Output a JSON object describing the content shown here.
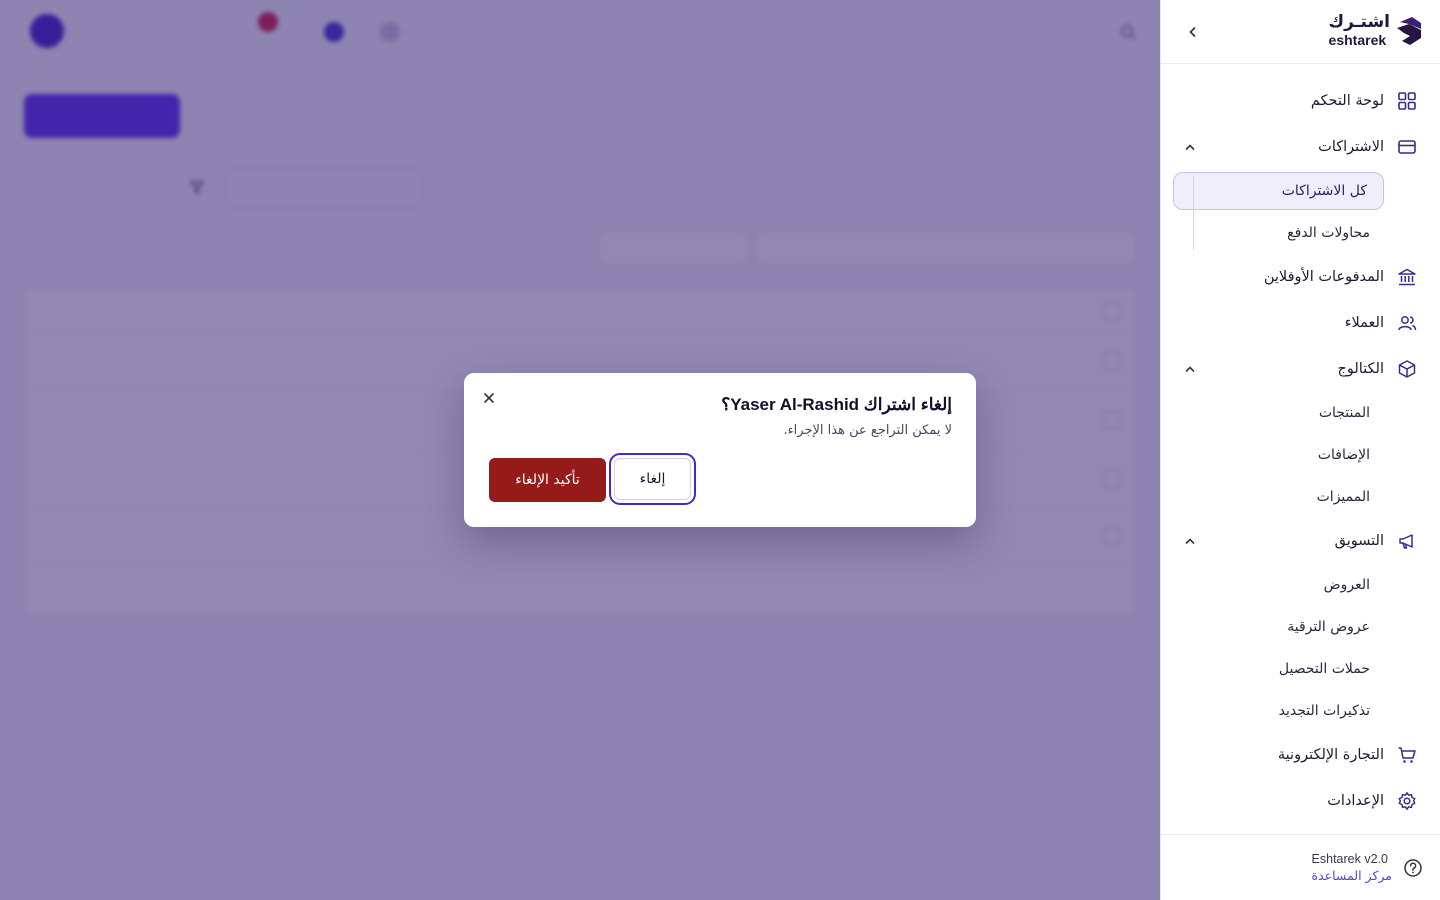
{
  "brand": {
    "name_ar": "اشتـرك",
    "name_en": "eshtarek"
  },
  "sidebar": {
    "items": [
      {
        "label": "لوحة التحكم",
        "icon": "dashboard-icon"
      },
      {
        "label": "الاشتراكات",
        "icon": "card-icon",
        "expanded": true,
        "children": [
          {
            "label": "كل الاشتراكات",
            "active": true
          },
          {
            "label": "محاولات الدفع"
          }
        ]
      },
      {
        "label": "المدفوعات الأوفلاين",
        "icon": "bank-icon"
      },
      {
        "label": "العملاء",
        "icon": "users-icon"
      },
      {
        "label": "الكتالوج",
        "icon": "box-icon",
        "expanded": true,
        "children": [
          {
            "label": "المنتجات"
          },
          {
            "label": "الإضافات"
          },
          {
            "label": "المميزات"
          }
        ]
      },
      {
        "label": "التسويق",
        "icon": "megaphone-icon",
        "expanded": true,
        "children": [
          {
            "label": "العروض"
          },
          {
            "label": "عروض الترقية"
          },
          {
            "label": "حملات التحصيل"
          },
          {
            "label": "تذكيرات التجديد"
          }
        ]
      },
      {
        "label": "التجارة الإلكترونية",
        "icon": "cart-icon"
      },
      {
        "label": "الإعدادات",
        "icon": "gear-icon"
      }
    ],
    "footer": {
      "version": "Eshtarek v2.0",
      "help": "مركز المساعدة"
    }
  },
  "modal": {
    "title": "إلغاء اشتراك Yaser Al-Rashid؟",
    "description": "لا يمكن التراجع عن هذا الإجراء.",
    "cancel_label": "إلغاء",
    "confirm_label": "تأكيد الإلغاء"
  },
  "colors": {
    "accent": "#4a25c8",
    "danger": "#951b1b",
    "overlay": "#2e1c6e"
  }
}
